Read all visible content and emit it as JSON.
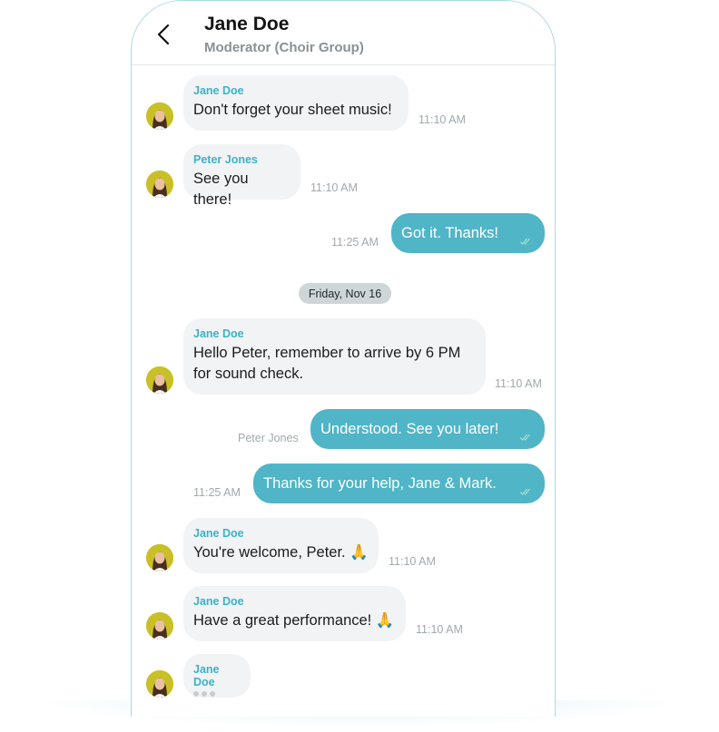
{
  "header": {
    "title": "Jane Doe",
    "subtitle": "Moderator (Choir Group)"
  },
  "date_separator": "Friday, Nov 16",
  "messages": [
    {
      "sender": "Jane Doe",
      "text": "Don't forget your sheet music!",
      "time": "11:10 AM"
    },
    {
      "sender": "Peter Jones",
      "text": "See you there!",
      "time": "11:10 AM"
    },
    {
      "text": "Got it. Thanks!",
      "time": "11:25 AM"
    },
    {
      "sender": "Jane Doe",
      "text": "Hello Peter, remember to arrive by 6 PM for sound check.",
      "time": "11:10 AM"
    },
    {
      "text": "Understood. See you later!",
      "side_label": "Peter Jones"
    },
    {
      "text": "Thanks for your help, Jane & Mark.",
      "time": "11:25 AM"
    },
    {
      "sender": "Jane Doe",
      "text": "You're welcome, Peter. 🙏",
      "time": "11:10 AM"
    },
    {
      "sender": "Jane Doe",
      "text": "Have a great performance! 🙏",
      "time": "11:10 AM"
    },
    {
      "sender": "Jane Doe",
      "typing": true
    }
  ],
  "colors": {
    "accent": "#3eb2c6",
    "outgoing_bubble": "#4fb5c7",
    "incoming_bubble": "#f1f3f4",
    "frame_border": "#a8dbe6"
  },
  "icons": {
    "back": "chevron-left-icon",
    "read_receipt": "double-check-icon",
    "avatar": "user-avatar"
  }
}
